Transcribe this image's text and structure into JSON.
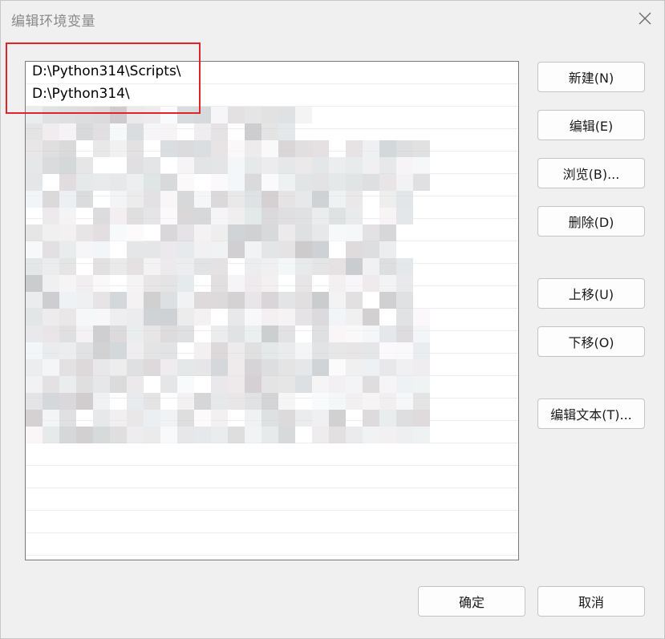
{
  "window": {
    "title": "编辑环境变量"
  },
  "list": {
    "items": [
      "D:\\Python314\\Scripts\\",
      "D:\\Python314\\"
    ]
  },
  "buttons": {
    "new": "新建(N)",
    "edit": "编辑(E)",
    "browse": "浏览(B)...",
    "delete": "删除(D)",
    "move_up": "上移(U)",
    "move_down": "下移(O)",
    "edit_text": "编辑文本(T)...",
    "ok": "确定",
    "cancel": "取消"
  },
  "colors": {
    "highlight": "#e0242a",
    "background": "#f0f0f0"
  },
  "icons": {
    "close": "close-icon"
  }
}
